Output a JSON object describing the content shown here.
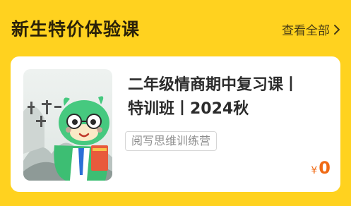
{
  "section": {
    "title": "新生特价体验课",
    "view_all_label": "查看全部"
  },
  "course": {
    "title_line1": "二年级情商期中复习课丨",
    "title_line2": "特训班丨2024秋",
    "tag": "阅写思维训练营",
    "currency": "¥",
    "price": "0"
  },
  "colors": {
    "background": "#ffd21f",
    "price": "#f06a14"
  },
  "icons": {
    "view_all": "chevron-right-icon",
    "thumbnail": "dragon-mascot-illustration"
  }
}
